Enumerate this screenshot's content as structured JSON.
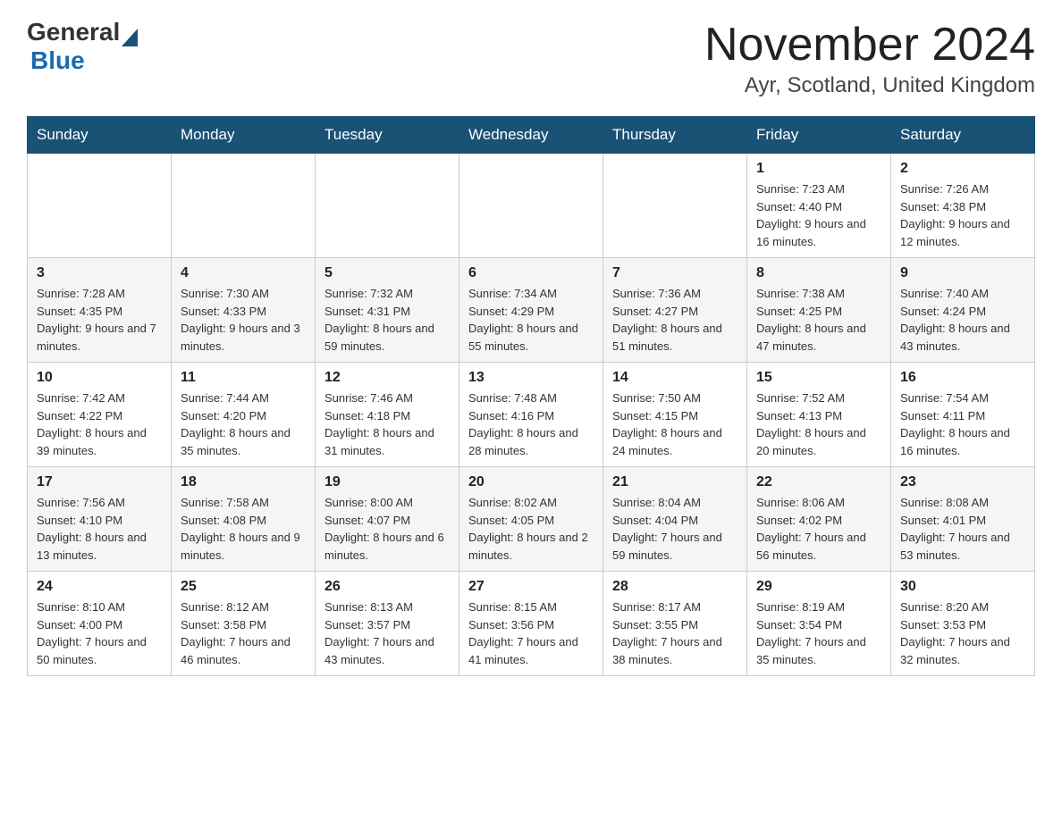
{
  "header": {
    "logo_general": "General",
    "logo_blue": "Blue",
    "month_title": "November 2024",
    "location": "Ayr, Scotland, United Kingdom"
  },
  "days_of_week": [
    "Sunday",
    "Monday",
    "Tuesday",
    "Wednesday",
    "Thursday",
    "Friday",
    "Saturday"
  ],
  "weeks": [
    {
      "days": [
        {
          "num": "",
          "info": ""
        },
        {
          "num": "",
          "info": ""
        },
        {
          "num": "",
          "info": ""
        },
        {
          "num": "",
          "info": ""
        },
        {
          "num": "",
          "info": ""
        },
        {
          "num": "1",
          "info": "Sunrise: 7:23 AM\nSunset: 4:40 PM\nDaylight: 9 hours and 16 minutes."
        },
        {
          "num": "2",
          "info": "Sunrise: 7:26 AM\nSunset: 4:38 PM\nDaylight: 9 hours and 12 minutes."
        }
      ]
    },
    {
      "days": [
        {
          "num": "3",
          "info": "Sunrise: 7:28 AM\nSunset: 4:35 PM\nDaylight: 9 hours and 7 minutes."
        },
        {
          "num": "4",
          "info": "Sunrise: 7:30 AM\nSunset: 4:33 PM\nDaylight: 9 hours and 3 minutes."
        },
        {
          "num": "5",
          "info": "Sunrise: 7:32 AM\nSunset: 4:31 PM\nDaylight: 8 hours and 59 minutes."
        },
        {
          "num": "6",
          "info": "Sunrise: 7:34 AM\nSunset: 4:29 PM\nDaylight: 8 hours and 55 minutes."
        },
        {
          "num": "7",
          "info": "Sunrise: 7:36 AM\nSunset: 4:27 PM\nDaylight: 8 hours and 51 minutes."
        },
        {
          "num": "8",
          "info": "Sunrise: 7:38 AM\nSunset: 4:25 PM\nDaylight: 8 hours and 47 minutes."
        },
        {
          "num": "9",
          "info": "Sunrise: 7:40 AM\nSunset: 4:24 PM\nDaylight: 8 hours and 43 minutes."
        }
      ]
    },
    {
      "days": [
        {
          "num": "10",
          "info": "Sunrise: 7:42 AM\nSunset: 4:22 PM\nDaylight: 8 hours and 39 minutes."
        },
        {
          "num": "11",
          "info": "Sunrise: 7:44 AM\nSunset: 4:20 PM\nDaylight: 8 hours and 35 minutes."
        },
        {
          "num": "12",
          "info": "Sunrise: 7:46 AM\nSunset: 4:18 PM\nDaylight: 8 hours and 31 minutes."
        },
        {
          "num": "13",
          "info": "Sunrise: 7:48 AM\nSunset: 4:16 PM\nDaylight: 8 hours and 28 minutes."
        },
        {
          "num": "14",
          "info": "Sunrise: 7:50 AM\nSunset: 4:15 PM\nDaylight: 8 hours and 24 minutes."
        },
        {
          "num": "15",
          "info": "Sunrise: 7:52 AM\nSunset: 4:13 PM\nDaylight: 8 hours and 20 minutes."
        },
        {
          "num": "16",
          "info": "Sunrise: 7:54 AM\nSunset: 4:11 PM\nDaylight: 8 hours and 16 minutes."
        }
      ]
    },
    {
      "days": [
        {
          "num": "17",
          "info": "Sunrise: 7:56 AM\nSunset: 4:10 PM\nDaylight: 8 hours and 13 minutes."
        },
        {
          "num": "18",
          "info": "Sunrise: 7:58 AM\nSunset: 4:08 PM\nDaylight: 8 hours and 9 minutes."
        },
        {
          "num": "19",
          "info": "Sunrise: 8:00 AM\nSunset: 4:07 PM\nDaylight: 8 hours and 6 minutes."
        },
        {
          "num": "20",
          "info": "Sunrise: 8:02 AM\nSunset: 4:05 PM\nDaylight: 8 hours and 2 minutes."
        },
        {
          "num": "21",
          "info": "Sunrise: 8:04 AM\nSunset: 4:04 PM\nDaylight: 7 hours and 59 minutes."
        },
        {
          "num": "22",
          "info": "Sunrise: 8:06 AM\nSunset: 4:02 PM\nDaylight: 7 hours and 56 minutes."
        },
        {
          "num": "23",
          "info": "Sunrise: 8:08 AM\nSunset: 4:01 PM\nDaylight: 7 hours and 53 minutes."
        }
      ]
    },
    {
      "days": [
        {
          "num": "24",
          "info": "Sunrise: 8:10 AM\nSunset: 4:00 PM\nDaylight: 7 hours and 50 minutes."
        },
        {
          "num": "25",
          "info": "Sunrise: 8:12 AM\nSunset: 3:58 PM\nDaylight: 7 hours and 46 minutes."
        },
        {
          "num": "26",
          "info": "Sunrise: 8:13 AM\nSunset: 3:57 PM\nDaylight: 7 hours and 43 minutes."
        },
        {
          "num": "27",
          "info": "Sunrise: 8:15 AM\nSunset: 3:56 PM\nDaylight: 7 hours and 41 minutes."
        },
        {
          "num": "28",
          "info": "Sunrise: 8:17 AM\nSunset: 3:55 PM\nDaylight: 7 hours and 38 minutes."
        },
        {
          "num": "29",
          "info": "Sunrise: 8:19 AM\nSunset: 3:54 PM\nDaylight: 7 hours and 35 minutes."
        },
        {
          "num": "30",
          "info": "Sunrise: 8:20 AM\nSunset: 3:53 PM\nDaylight: 7 hours and 32 minutes."
        }
      ]
    }
  ]
}
